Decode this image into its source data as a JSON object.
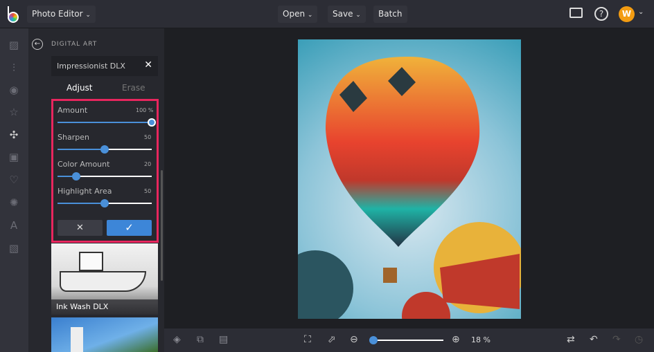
{
  "topbar": {
    "app_menu": "Photo Editor",
    "open": "Open",
    "save": "Save",
    "batch": "Batch",
    "avatar": "W"
  },
  "panel": {
    "section": "DIGITAL ART",
    "effect_title": "Impressionist DLX",
    "tabs": [
      "Adjust",
      "Erase"
    ],
    "sliders": [
      {
        "label": "Amount",
        "value_text": "100 %",
        "value": 100
      },
      {
        "label": "Sharpen",
        "value_text": "50",
        "value": 50
      },
      {
        "label": "Color Amount",
        "value_text": "20",
        "value": 20
      },
      {
        "label": "Highlight Area",
        "value_text": "50",
        "value": 50
      }
    ],
    "thumbnails": [
      {
        "label": "Ink Wash DLX"
      }
    ]
  },
  "bottom": {
    "zoom": "18 %",
    "zoom_value": 18
  },
  "colors": {
    "accent": "#4a90d9",
    "highlight": "#e8265e",
    "avatar": "#f39c12"
  }
}
